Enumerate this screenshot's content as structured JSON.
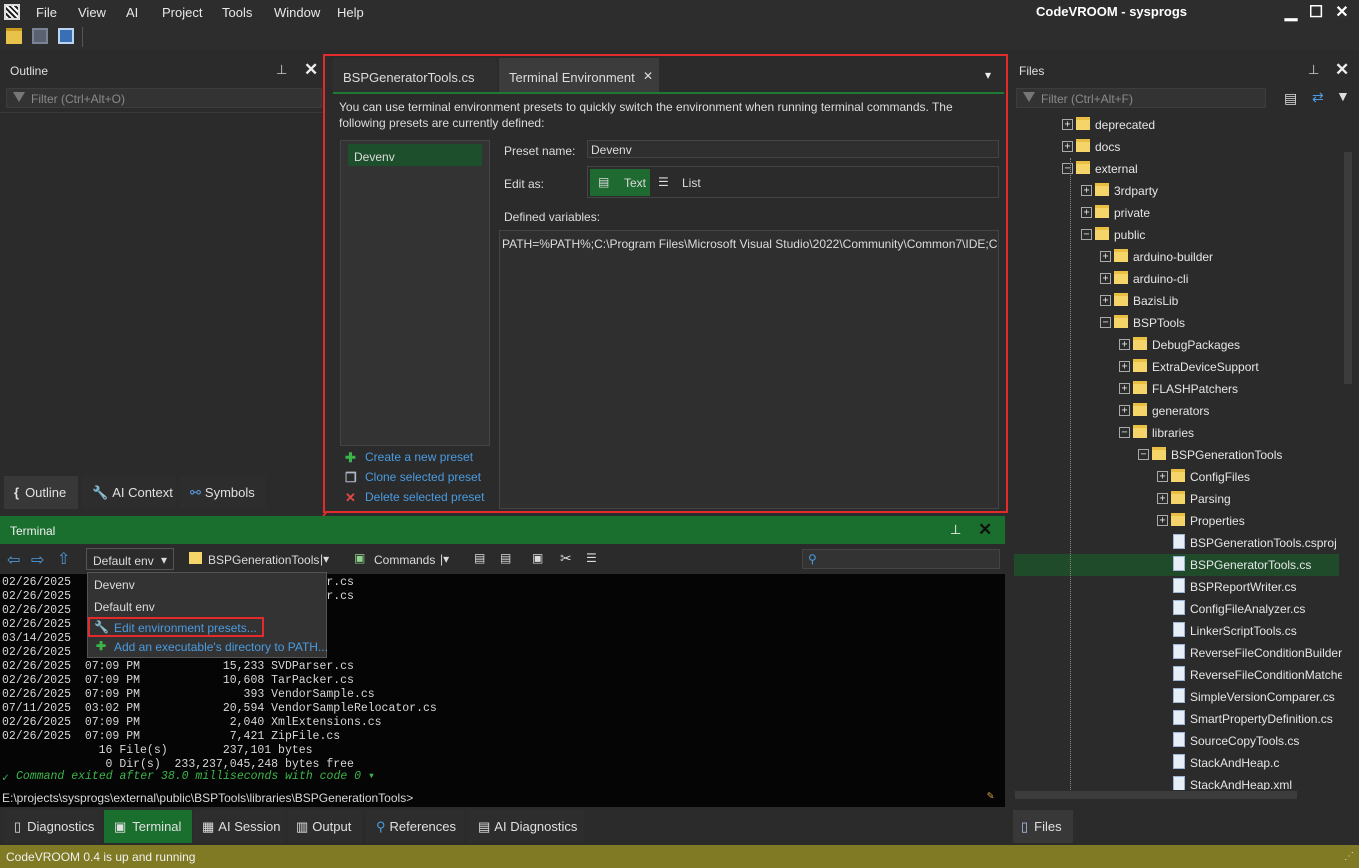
{
  "menu": [
    "File",
    "View",
    "AI",
    "Project",
    "Tools",
    "Window",
    "Help"
  ],
  "app_title": "CodeVROOM - sysprogs",
  "outline": {
    "title": "Outline",
    "filter_placeholder": "Filter (Ctrl+Alt+O)"
  },
  "left_tabs": [
    {
      "label": "Outline"
    },
    {
      "label": "AI Context"
    },
    {
      "label": "Symbols"
    }
  ],
  "doc_tabs": [
    {
      "label": "BSPGeneratorTools.cs"
    },
    {
      "label": "Terminal Environment"
    }
  ],
  "env": {
    "intro_line1": "You can use terminal environment presets to quickly switch the environment when running terminal commands. The",
    "intro_line2": "following presets are currently defined:",
    "presets": [
      "Devenv"
    ],
    "preset_name_label": "Preset name:",
    "preset_name_value": "Devenv",
    "edit_as_label": "Edit as:",
    "edit_as_text": "Text",
    "edit_as_list": "List",
    "defined_vars_label": "Defined variables:",
    "vars_value": "PATH=%PATH%;C:\\Program Files\\Microsoft Visual Studio\\2022\\Community\\Common7\\IDE;C:\\",
    "create": "Create a new preset",
    "clone": "Clone selected preset",
    "delete": "Delete selected preset"
  },
  "files": {
    "title": "Files",
    "filter_placeholder": "Filter (Ctrl+Alt+F)",
    "tree": [
      {
        "label": "deprecated",
        "type": "folder",
        "indent": 0,
        "exp": "+"
      },
      {
        "label": "docs",
        "type": "folder",
        "indent": 0,
        "exp": "+"
      },
      {
        "label": "external",
        "type": "folder",
        "indent": 0,
        "exp": "-"
      },
      {
        "label": "3rdparty",
        "type": "folder",
        "indent": 1,
        "exp": "+"
      },
      {
        "label": "private",
        "type": "folder",
        "indent": 1,
        "exp": "+"
      },
      {
        "label": "public",
        "type": "folder",
        "indent": 1,
        "exp": "-"
      },
      {
        "label": "arduino-builder",
        "type": "folder",
        "indent": 2,
        "exp": "+"
      },
      {
        "label": "arduino-cli",
        "type": "folder",
        "indent": 2,
        "exp": "+"
      },
      {
        "label": "BazisLib",
        "type": "folder",
        "indent": 2,
        "exp": "+"
      },
      {
        "label": "BSPTools",
        "type": "folder",
        "indent": 2,
        "exp": "-"
      },
      {
        "label": "DebugPackages",
        "type": "folder",
        "indent": 3,
        "exp": "+"
      },
      {
        "label": "ExtraDeviceSupport",
        "type": "folder",
        "indent": 3,
        "exp": "+"
      },
      {
        "label": "FLASHPatchers",
        "type": "folder",
        "indent": 3,
        "exp": "+"
      },
      {
        "label": "generators",
        "type": "folder",
        "indent": 3,
        "exp": "+"
      },
      {
        "label": "libraries",
        "type": "folder",
        "indent": 3,
        "exp": "-"
      },
      {
        "label": "BSPGenerationTools",
        "type": "folder",
        "indent": 4,
        "exp": "-"
      },
      {
        "label": "ConfigFiles",
        "type": "folder",
        "indent": 5,
        "exp": "+"
      },
      {
        "label": "Parsing",
        "type": "folder",
        "indent": 5,
        "exp": "+"
      },
      {
        "label": "Properties",
        "type": "folder",
        "indent": 5,
        "exp": "+"
      },
      {
        "label": "BSPGenerationTools.csproj",
        "type": "file",
        "indent": 5
      },
      {
        "label": "BSPGeneratorTools.cs",
        "type": "file",
        "indent": 5,
        "selected": true
      },
      {
        "label": "BSPReportWriter.cs",
        "type": "file",
        "indent": 5
      },
      {
        "label": "ConfigFileAnalyzer.cs",
        "type": "file",
        "indent": 5
      },
      {
        "label": "LinkerScriptTools.cs",
        "type": "file",
        "indent": 5
      },
      {
        "label": "ReverseFileConditionBuilder.",
        "type": "file",
        "indent": 5
      },
      {
        "label": "ReverseFileConditionMatche",
        "type": "file",
        "indent": 5
      },
      {
        "label": "SimpleVersionComparer.cs",
        "type": "file",
        "indent": 5
      },
      {
        "label": "SmartPropertyDefinition.cs",
        "type": "file",
        "indent": 5
      },
      {
        "label": "SourceCopyTools.cs",
        "type": "file",
        "indent": 5
      },
      {
        "label": "StackAndHeap.c",
        "type": "file",
        "indent": 5
      },
      {
        "label": "StackAndHeap.xml",
        "type": "file",
        "indent": 5
      }
    ]
  },
  "files_tab": "Files",
  "terminal": {
    "title": "Terminal",
    "env_dropdown": "Default env",
    "project_dropdown": "BSPGenerationTools",
    "commands": "Commands",
    "lines": [
      "02/26/2025                   ileConditionBuilder.cs",
      "02/26/2025                   ileConditionMatcher.cs",
      "02/26/2025                   rsionComparer.cs",
      "02/26/2025                   pertyDefinition.cs",
      "03/14/2025                   pyTools.cs",
      "02/26/2025                   ileGenerator.cs",
      "02/26/2025  07:09 PM            15,233 SVDParser.cs",
      "02/26/2025  07:09 PM            10,608 TarPacker.cs",
      "02/26/2025  07:09 PM               393 VendorSample.cs",
      "07/11/2025  03:02 PM            20,594 VendorSampleRelocator.cs",
      "02/26/2025  07:09 PM             2,040 XmlExtensions.cs",
      "02/26/2025  07:09 PM             7,421 ZipFile.cs",
      "              16 File(s)        237,101 bytes",
      "               0 Dir(s)  233,237,045,248 bytes free"
    ],
    "exit_line": "Command exited after 38.0 milliseconds with code 0 ▾",
    "prompt": "E:\\projects\\sysprogs\\external\\public\\BSPTools\\libraries\\BSPGenerationTools>"
  },
  "dropdown": {
    "items": [
      "Devenv",
      "Default env"
    ],
    "edit": "Edit environment presets...",
    "add": "Add an executable's directory to PATH..."
  },
  "bottom_tabs": [
    {
      "label": "Diagnostics"
    },
    {
      "label": "Terminal"
    },
    {
      "label": "AI Session"
    },
    {
      "label": "Output"
    },
    {
      "label": "References"
    },
    {
      "label": "AI Diagnostics"
    }
  ],
  "status": "CodeVROOM 0.4 is up and running"
}
